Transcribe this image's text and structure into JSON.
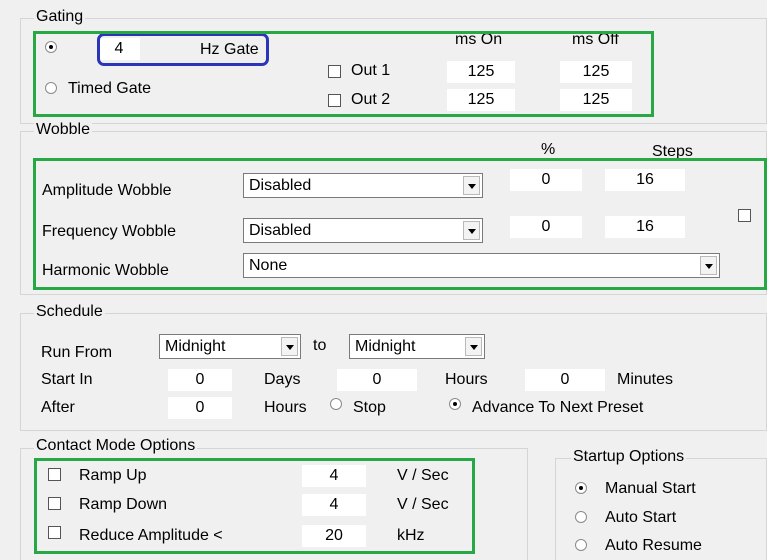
{
  "gating": {
    "legend": "Gating",
    "hz_value": "4",
    "hz_label": "Hz Gate",
    "timed_label": "Timed Gate",
    "ms_on_header": "ms On",
    "ms_off_header": "ms Off",
    "out1_label": "Out 1",
    "out2_label": "Out 2",
    "out1_on": "125",
    "out1_off": "125",
    "out2_on": "125",
    "out2_off": "125"
  },
  "wobble": {
    "legend": "Wobble",
    "pct_header": "%",
    "steps_header": "Steps",
    "amplitude_label": "Amplitude Wobble",
    "amplitude_select": "Disabled",
    "amplitude_pct": "0",
    "amplitude_steps": "16",
    "frequency_label": "Frequency Wobble",
    "frequency_select": "Disabled",
    "frequency_pct": "0",
    "frequency_steps": "16",
    "harmonic_label": "Harmonic Wobble",
    "harmonic_select": "None"
  },
  "schedule": {
    "legend": "Schedule",
    "run_from_label": "Run From",
    "from_select": "Midnight",
    "to_label": "to",
    "to_select": "Midnight",
    "start_in_label": "Start In",
    "start_days": "0",
    "days_label": "Days",
    "start_hours": "0",
    "hours_label": "Hours",
    "start_minutes": "0",
    "minutes_label": "Minutes",
    "after_label": "After",
    "after_hours": "0",
    "after_hours_label": "Hours",
    "stop_label": "Stop",
    "advance_label": "Advance To Next Preset"
  },
  "contact": {
    "legend": "Contact Mode Options",
    "ramp_up_label": "Ramp Up",
    "ramp_up_value": "4",
    "ramp_up_unit": "V / Sec",
    "ramp_down_label": "Ramp Down",
    "ramp_down_value": "4",
    "ramp_down_unit": "V / Sec",
    "reduce_label": "Reduce Amplitude <",
    "reduce_value": "20",
    "reduce_unit": "kHz"
  },
  "startup": {
    "legend": "Startup Options",
    "manual_label": "Manual Start",
    "auto_start_label": "Auto Start",
    "auto_resume_label": "Auto Resume"
  }
}
